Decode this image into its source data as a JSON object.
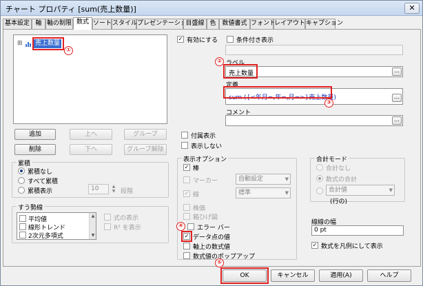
{
  "window": {
    "title": "チャート プロパティ [sum(売上数量)]",
    "close_icon": "close-icon"
  },
  "tabs": [
    "基本設定",
    "軸",
    "軸の制限",
    "数式",
    "ソート",
    "スタイル",
    "プレゼンテーション",
    "目盛線",
    "色",
    "数値書式",
    "フォント",
    "レイアウト",
    "キャプション"
  ],
  "active_tab": "数式",
  "expressions": {
    "item": "売上数量",
    "expand_glyph": "⊞"
  },
  "buttons": {
    "add": "追加",
    "up": "上へ",
    "group": "グループ",
    "delete": "削除",
    "down": "下へ",
    "ungroup": "グループ解除"
  },
  "accumulation": {
    "title": "累積",
    "none": "累積なし",
    "all": "すべて累積",
    "display": "累積表示",
    "steps_value": "10",
    "steps_label": "段階"
  },
  "trendlines": {
    "title": "すう勢線",
    "items": [
      "平均値",
      "線形トレンド",
      "2次元多項式"
    ],
    "show_formula": "式の表示",
    "show_r2": "R² を表示"
  },
  "enable": "有効にする",
  "conditional": "条件付き表示",
  "label": {
    "title": "ラベル",
    "value": "売上数量"
  },
  "definition": {
    "title": "定義",
    "value": "sum ({<年月=,年=,月=>}売上数量)"
  },
  "comment": {
    "title": "コメント",
    "value": ""
  },
  "invisible": "非表示",
  "attr_expr": "付属表示",
  "hide": "表示しない",
  "display_options": {
    "title": "表示オプション",
    "bar": "棒",
    "marker": "マーカー",
    "line": "線",
    "marker_value": "自動設定",
    "line_value": "標準",
    "stem": "株価",
    "box": "箱ひげ図",
    "error_bar": "エラー バー",
    "data_values": "データ点の値",
    "text_on_axis": "軸上の数式値",
    "popup": "数式値のポップアップ"
  },
  "total_mode": {
    "title": "合計モード",
    "none": "合計なし",
    "sum": "数式の合計",
    "select_value": "合計値",
    "rows": "(行の)"
  },
  "stroke_width": {
    "title": "線線の幅",
    "value": "0 pt"
  },
  "show_in_legend": "数式を凡例にして表示",
  "footer": {
    "ok": "OK",
    "cancel": "キャンセル",
    "apply": "適用(A)",
    "help": "ヘルプ"
  },
  "callouts": [
    "①",
    "②",
    "③",
    "④",
    "⑤"
  ],
  "accent": {
    "red": "#e02020",
    "selection": "#3b6fd0"
  }
}
